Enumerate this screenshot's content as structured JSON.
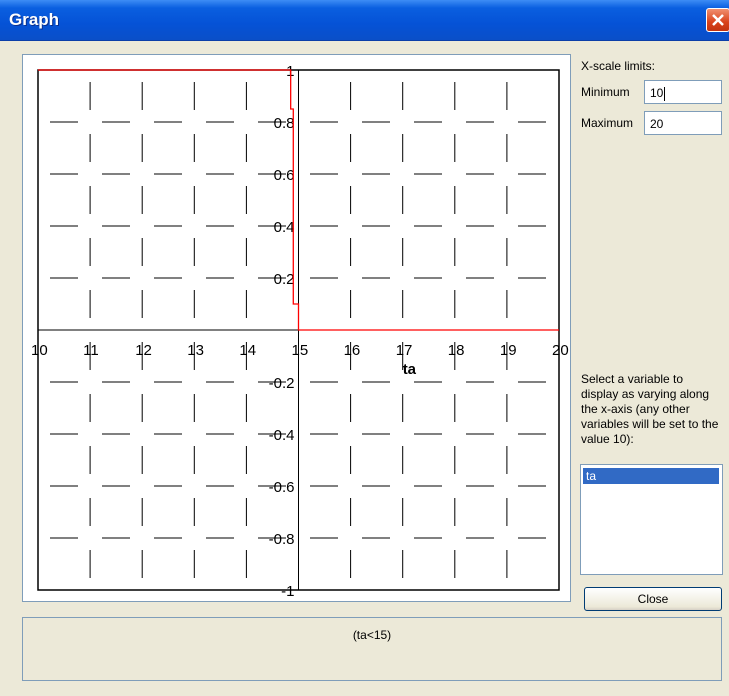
{
  "window": {
    "title": "Graph"
  },
  "xscale": {
    "heading": "X-scale limits:",
    "min_label": "Minimum",
    "min_value": "10",
    "max_label": "Maximum",
    "max_value": "20"
  },
  "variable_prompt": "Select a variable to display as varying along the x-axis (any other variables will be set to the value 10):",
  "variables": [
    "ta"
  ],
  "selected_variable": "ta",
  "close_label": "Close",
  "expression": "(ta<15)",
  "colors": {
    "curve": "#ff0000",
    "axis": "#000000",
    "grid": "#000000"
  },
  "chart_data": {
    "type": "line",
    "xlabel": "ta",
    "ylabel": "",
    "xlim": [
      10,
      20
    ],
    "ylim": [
      -1,
      1
    ],
    "x_ticks": [
      "10",
      "11",
      "12",
      "13",
      "14",
      "15",
      "16",
      "17",
      "18",
      "19",
      "20"
    ],
    "y_ticks": [
      "1",
      "0.8",
      "0.6",
      "0.4",
      "0.2",
      "-0.2",
      "-0.4",
      "-0.6",
      "-0.8",
      "-1"
    ],
    "grid": true,
    "series": [
      {
        "x": [
          10,
          14.85,
          14.85,
          14.9,
          14.9,
          15,
          15,
          20
        ],
        "y": [
          1,
          1,
          0.85,
          0.85,
          0.1,
          0.1,
          0,
          0
        ]
      }
    ]
  }
}
